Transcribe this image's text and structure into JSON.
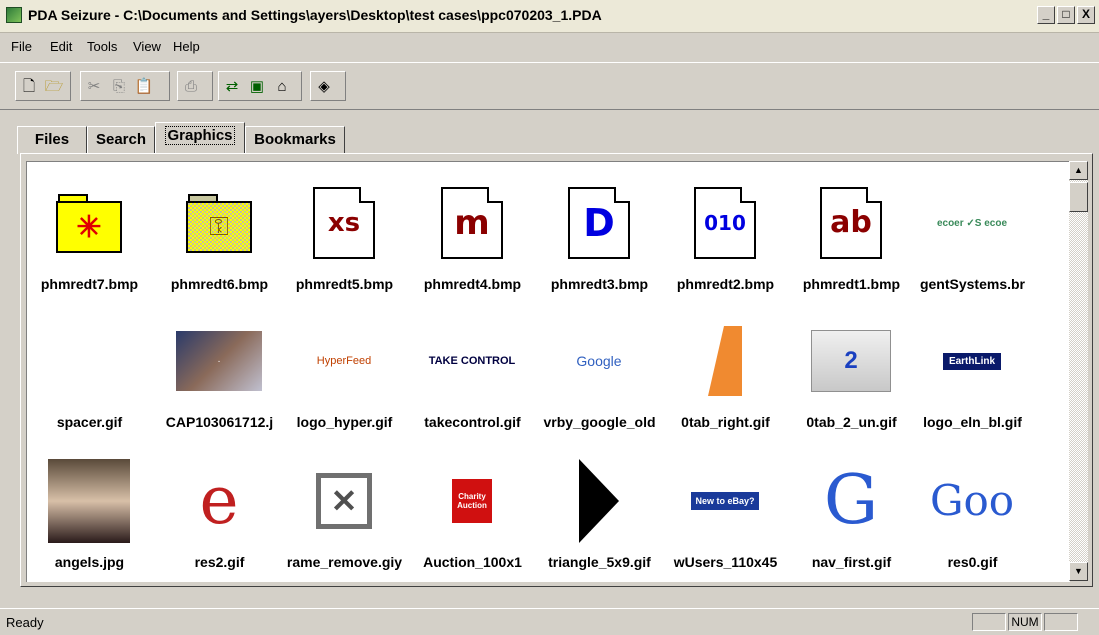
{
  "window": {
    "title": "PDA Seizure - C:\\Documents and Settings\\ayers\\Desktop\\test cases\\ppc070203_1.PDA",
    "minimize": "_",
    "maximize": "□",
    "close": "X"
  },
  "menu": [
    "File",
    "Edit",
    "Tools",
    "View",
    "Help"
  ],
  "toolbar": {
    "groups": [
      [
        "new-icon",
        "open-icon"
      ],
      [
        "cut-icon",
        "copy-icon",
        "paste-icon"
      ],
      [
        "print-icon"
      ],
      [
        "acquire-icon",
        "device-icon",
        "import-icon"
      ],
      [
        "about-icon"
      ]
    ]
  },
  "tabs": [
    "Files",
    "Search",
    "Graphics",
    "Bookmarks"
  ],
  "active_tab": "Graphics",
  "graphics": [
    {
      "name": "phmredt7.bmp",
      "kind": "folder"
    },
    {
      "name": "phmredt6.bmp",
      "kind": "folder-key"
    },
    {
      "name": "phmredt5.bmp",
      "kind": "doc",
      "glyph": "xs"
    },
    {
      "name": "phmredt4.bmp",
      "kind": "doc",
      "glyph": "m"
    },
    {
      "name": "phmredt3.bmp",
      "kind": "doc",
      "glyph": "D"
    },
    {
      "name": "phmredt2.bmp",
      "kind": "doc",
      "glyph": "010"
    },
    {
      "name": "phmredt1.bmp",
      "kind": "doc",
      "glyph": "ab"
    },
    {
      "name": "gentSystems.br",
      "kind": "text-logo",
      "glyph": "ecoer ✓S ecoe"
    },
    {
      "name": "spacer.gif",
      "kind": "empty"
    },
    {
      "name": "CAP103061712.j",
      "kind": "photo"
    },
    {
      "name": "logo_hyper.gif",
      "kind": "text-logo",
      "glyph": "HyperFeed"
    },
    {
      "name": "takecontrol.gif",
      "kind": "text-logo",
      "glyph": "TAKE CONTROL"
    },
    {
      "name": "vrby_google_old",
      "kind": "text-logo",
      "glyph": "Google"
    },
    {
      "name": "0tab_right.gif",
      "kind": "orange-tab"
    },
    {
      "name": "0tab_2_un.gif",
      "kind": "grey-tab",
      "glyph": "2"
    },
    {
      "name": "logo_eln_bl.gif",
      "kind": "earthlink",
      "glyph": "EarthLink"
    },
    {
      "name": "angels.jpg",
      "kind": "photo2"
    },
    {
      "name": "res2.gif",
      "kind": "ie-logo",
      "glyph": "e"
    },
    {
      "name": "rame_remove.giy",
      "kind": "remove-x"
    },
    {
      "name": "Auction_100x1",
      "kind": "auction",
      "glyph": "Charity Auction"
    },
    {
      "name": "triangle_5x9.gif",
      "kind": "triangle"
    },
    {
      "name": "wUsers_110x45",
      "kind": "ebay",
      "glyph": "New to eBay?"
    },
    {
      "name": "nav_first.gif",
      "kind": "google-g",
      "glyph": "G"
    },
    {
      "name": "res0.gif",
      "kind": "goo",
      "glyph": "Goo"
    }
  ],
  "scrollbar": {
    "up": "▲",
    "down": "▼"
  },
  "status": {
    "text": "Ready",
    "num": "NUM"
  }
}
